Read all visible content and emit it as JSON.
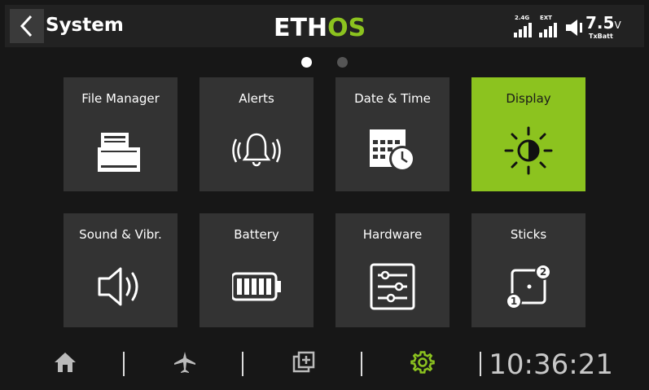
{
  "header": {
    "title": "System",
    "logo_left": "ETH",
    "logo_right": "OS",
    "signal_label": "2.4G",
    "ext_label": "EXT",
    "battery_voltage": "7.5",
    "battery_unit": "V",
    "battery_label": "TxBatt"
  },
  "pager": {
    "pages": 2,
    "current": 1
  },
  "tiles": [
    {
      "label": "File Manager",
      "icon": "file-manager-icon",
      "active": false
    },
    {
      "label": "Alerts",
      "icon": "bell-icon",
      "active": false
    },
    {
      "label": "Date & Time",
      "icon": "calendar-clock-icon",
      "active": false
    },
    {
      "label": "Display",
      "icon": "brightness-icon",
      "active": true
    },
    {
      "label": "Sound & Vibr.",
      "icon": "speaker-icon",
      "active": false
    },
    {
      "label": "Battery",
      "icon": "battery-icon",
      "active": false
    },
    {
      "label": "Hardware",
      "icon": "sliders-icon",
      "active": false
    },
    {
      "label": "Sticks",
      "icon": "sticks-icon",
      "active": false
    }
  ],
  "bottom_bar": {
    "items": [
      "home-icon",
      "airplane-icon",
      "model-setup-icon",
      "gear-icon"
    ],
    "active": "gear-icon",
    "clock": "10:36:21"
  },
  "colors": {
    "accent": "#8cc31f",
    "tile": "#333333",
    "background": "#171717"
  }
}
